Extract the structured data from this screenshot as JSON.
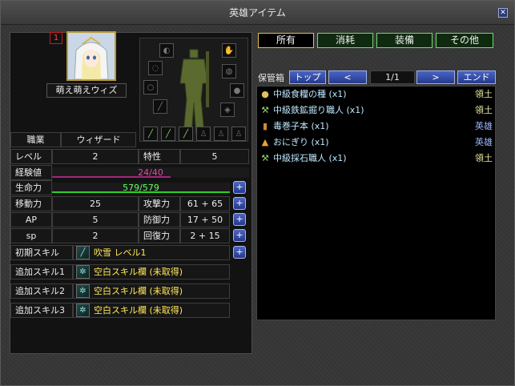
{
  "window": {
    "title": "英雄アイテム",
    "close_glyph": "✕"
  },
  "hero": {
    "number": "1",
    "name": "萌え萌えウィズ",
    "portrait_desc_icon": "hero-portrait"
  },
  "stats": {
    "job_label": "職業",
    "job_value": "ウィザード",
    "level_label": "レベル",
    "level_value": "2",
    "trait_label": "特性",
    "trait_value": "5",
    "exp_label": "経験値",
    "exp_text": "24/40",
    "exp_current": 24,
    "exp_max": 40,
    "hp_label": "生命力",
    "hp_text": "579/579",
    "hp_current": 579,
    "hp_max": 579,
    "move_label": "移動力",
    "move_value": "25",
    "atk_label": "攻撃力",
    "atk_value": "61 + 65",
    "ap_label": "AP",
    "ap_value": "5",
    "def_label": "防御力",
    "def_value": "17 + 50",
    "sp_label": "sp",
    "sp_value": "2",
    "rec_label": "回復力",
    "rec_value": "2 + 15",
    "plus_glyph": "+"
  },
  "skills": [
    {
      "label": "初期スキル",
      "name": "吹雪 レベル1",
      "icon": "blizzard-icon"
    },
    {
      "label": "追加スキル1",
      "name": "空白スキル欄 (未取得)",
      "icon": "empty-skill-icon"
    },
    {
      "label": "追加スキル2",
      "name": "空白スキル欄 (未取得)",
      "icon": "empty-skill-icon"
    },
    {
      "label": "追加スキル3",
      "name": "空白スキル欄 (未取得)",
      "icon": "empty-skill-icon"
    }
  ],
  "tabs": [
    {
      "label": "所有",
      "active": true
    },
    {
      "label": "消耗",
      "active": false
    },
    {
      "label": "装備",
      "active": false
    },
    {
      "label": "その他",
      "active": false
    }
  ],
  "storage": {
    "label": "保管箱",
    "top_btn": "トップ",
    "prev_btn": "<",
    "page": "1/1",
    "next_btn": ">",
    "end_btn": "エンド"
  },
  "items": [
    {
      "name": "中級食糧の種 (x1)",
      "type": "領土",
      "type_color": "#e8e8a0",
      "icon": "seed-icon"
    },
    {
      "name": "中級鉄鉱掘り職人 (x1)",
      "type": "領土",
      "type_color": "#e8e8a0",
      "icon": "miner-icon"
    },
    {
      "name": "毒巻子本 (x1)",
      "type": "英雄",
      "type_color": "#9fb8ff",
      "icon": "scroll-icon"
    },
    {
      "name": "おにぎり (x1)",
      "type": "英雄",
      "type_color": "#9fb8ff",
      "icon": "riceball-icon"
    },
    {
      "name": "中級採石職人 (x1)",
      "type": "領土",
      "type_color": "#e8e8a0",
      "icon": "quarry-icon"
    }
  ],
  "colors": {
    "exp_bar": "#a0287a",
    "hp_bar": "#2bd02b",
    "exp_text": "#e04aa8",
    "hp_text": "#60ff60"
  }
}
